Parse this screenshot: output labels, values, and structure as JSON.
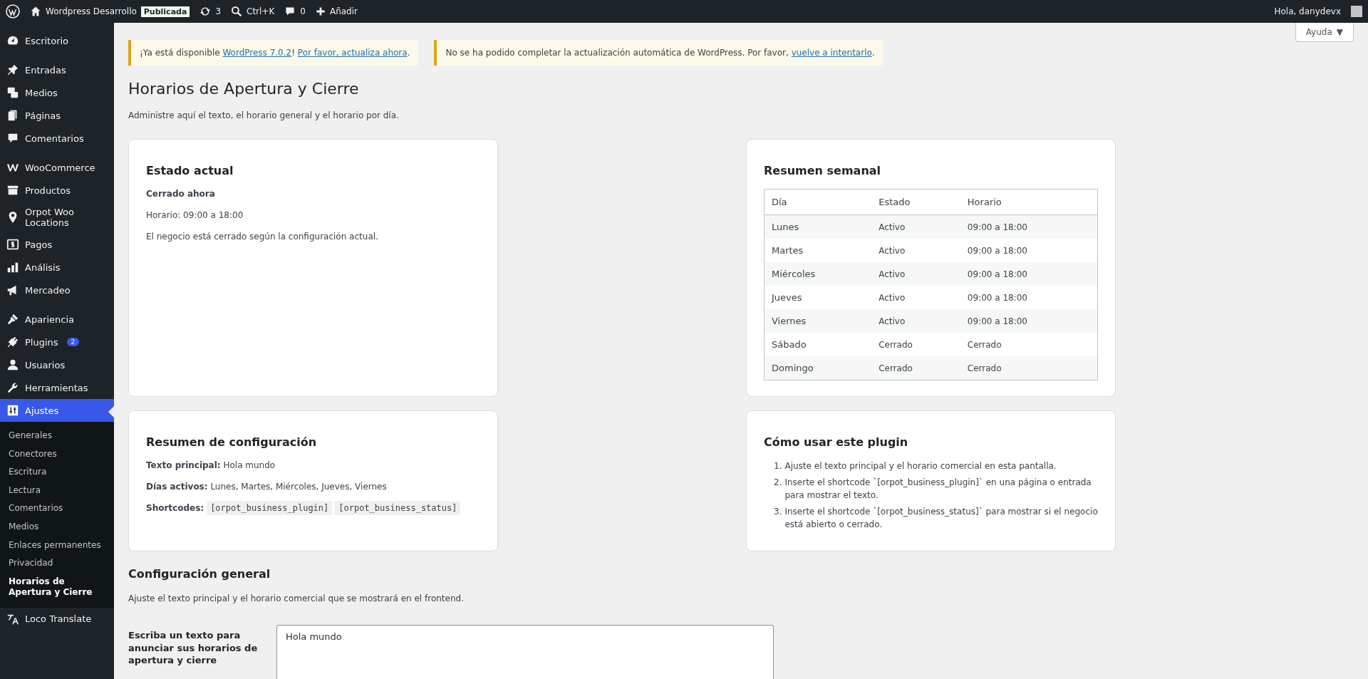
{
  "admin_bar": {
    "site_name": "Wordpress Desarrollo",
    "status_badge": "Publicada",
    "updates": "3",
    "search_shortcut": "Ctrl+K",
    "comments": "0",
    "add_new": "Añadir",
    "greeting": "Hola, danydevx"
  },
  "help_button": {
    "label": "Ayuda",
    "caret": "▼"
  },
  "sidebar": {
    "groups": [
      {
        "items": [
          {
            "label": "Escritorio",
            "selected": false
          }
        ]
      },
      {
        "items": [
          {
            "label": "Entradas",
            "selected": false
          },
          {
            "label": "Medios",
            "selected": false
          },
          {
            "label": "Páginas",
            "selected": false
          },
          {
            "label": "Comentarios",
            "selected": false
          }
        ]
      },
      {
        "items": [
          {
            "label": "WooCommerce",
            "selected": false
          },
          {
            "label": "Productos",
            "selected": false
          },
          {
            "label": "Orpot Woo Locations",
            "selected": false
          },
          {
            "label": "Pagos",
            "selected": false
          },
          {
            "label": "Análisis",
            "selected": false
          },
          {
            "label": "Mercadeo",
            "selected": false
          }
        ]
      },
      {
        "items": [
          {
            "label": "Apariencia",
            "selected": false
          },
          {
            "label": "Plugins",
            "selected": false,
            "badge": "2"
          },
          {
            "label": "Usuarios",
            "selected": false
          },
          {
            "label": "Herramientas",
            "selected": false
          },
          {
            "label": "Ajustes",
            "selected": true,
            "children": [
              {
                "label": "Generales",
                "selected": false
              },
              {
                "label": "Conectores",
                "selected": false
              },
              {
                "label": "Escritura",
                "selected": false
              },
              {
                "label": "Lectura",
                "selected": false
              },
              {
                "label": "Comentarios",
                "selected": false
              },
              {
                "label": "Medios",
                "selected": false
              },
              {
                "label": "Enlaces permanentes",
                "selected": false
              },
              {
                "label": "Privacidad",
                "selected": false
              },
              {
                "label": "Horarios de Apertura y Cierre",
                "selected": true
              }
            ]
          },
          {
            "label": "Loco Translate",
            "selected": false
          }
        ]
      }
    ]
  },
  "notices": [
    {
      "parts": [
        {
          "kind": "text",
          "text": "¡Ya está disponible "
        },
        {
          "kind": "link",
          "text": "WordPress 7.0.2"
        },
        {
          "kind": "text",
          "text": "! "
        },
        {
          "kind": "link",
          "text": "Por favor, actualiza ahora"
        },
        {
          "kind": "text",
          "text": "."
        }
      ]
    },
    {
      "parts": [
        {
          "kind": "text",
          "text": "No se ha podido completar la actualización automática de WordPress. Por favor, "
        },
        {
          "kind": "link",
          "text": "vuelve a intentarlo"
        },
        {
          "kind": "text",
          "text": "."
        }
      ]
    }
  ],
  "page": {
    "title": "Horarios de Apertura y Cierre",
    "description": "Administre aquí el texto, el horario general y el horario por día."
  },
  "cards": [
    {
      "kind": "status",
      "title": "Estado actual",
      "status": "Cerrado ahora",
      "lines": [
        "Horario: 09:00 a 18:00",
        "El negocio está cerrado según la configuración actual."
      ]
    },
    {
      "kind": "table",
      "title": "Resumen semanal",
      "columns": [
        "Día",
        "Estado",
        "Horario"
      ],
      "rows": [
        [
          "Lunes",
          "Activo",
          "09:00 a 18:00"
        ],
        [
          "Martes",
          "Activo",
          "09:00 a 18:00"
        ],
        [
          "Miércoles",
          "Activo",
          "09:00 a 18:00"
        ],
        [
          "Jueves",
          "Activo",
          "09:00 a 18:00"
        ],
        [
          "Viernes",
          "Activo",
          "09:00 a 18:00"
        ],
        [
          "Sábado",
          "Cerrado",
          "Cerrado"
        ],
        [
          "Domingo",
          "Cerrado",
          "Cerrado"
        ]
      ]
    },
    {
      "kind": "summary",
      "title": "Resumen de configuración",
      "lines": [
        "**Texto principal:** Hola mundo",
        "**Días activos:** Lunes, Martes, Miércoles, Jueves, Viernes"
      ],
      "shortcodes_label": "Shortcodes:",
      "shortcodes": [
        "[orpot_business_plugin]",
        "[orpot_business_status]"
      ]
    },
    {
      "kind": "steps",
      "title": "Cómo usar este plugin",
      "steps": [
        {
          "number": "1.",
          "text": "Ajuste el texto principal y el horario comercial en esta pantalla."
        },
        {
          "number": "2.",
          "text": "Inserte el shortcode `[orpot_business_plugin]` en una página o entrada para mostrar el texto."
        },
        {
          "number": "3.",
          "text": "Inserte el shortcode `[orpot_business_status]` para mostrar si el negocio está abierto o cerrado."
        }
      ]
    }
  ],
  "config_general": {
    "title": "Configuración general",
    "description": "Ajuste el texto principal y el horario comercial que se mostrará en el frontend.",
    "fields": [
      {
        "label": "Escriba un texto para anunciar sus horarios de apertura y cierre",
        "value": "Hola mundo"
      }
    ]
  }
}
